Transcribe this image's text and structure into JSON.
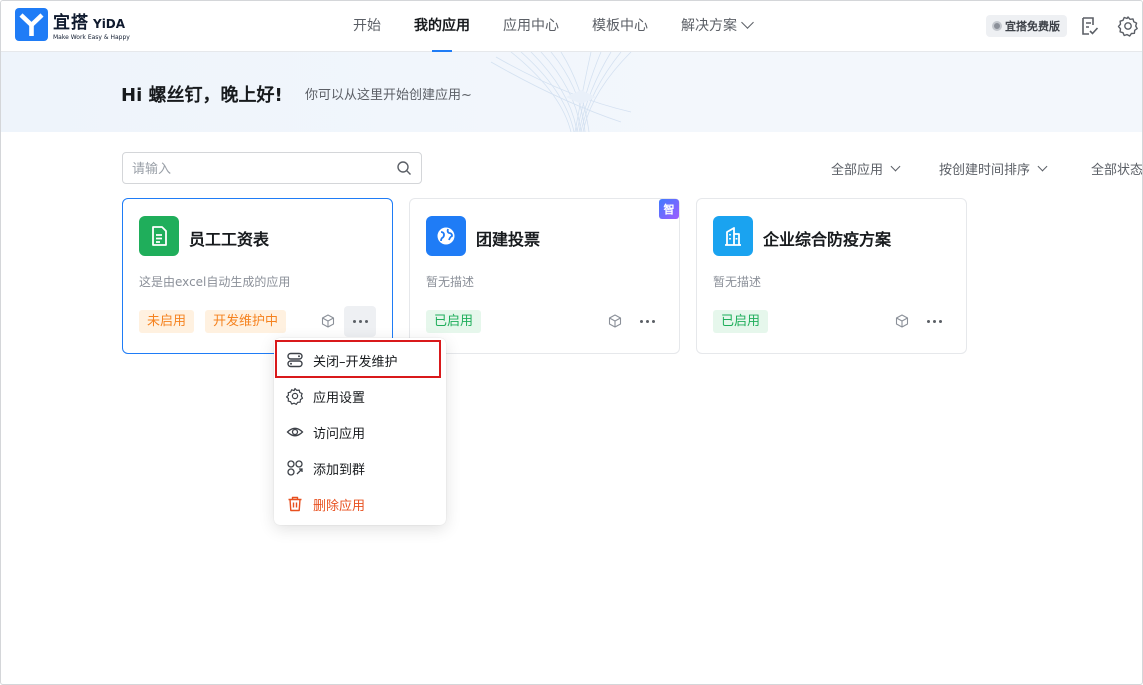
{
  "header": {
    "logo": {
      "cn": "宜搭",
      "en": "YiDA",
      "tagline": "Make Work Easy & Happy"
    },
    "nav": [
      {
        "label": "开始",
        "active": false
      },
      {
        "label": "我的应用",
        "active": true
      },
      {
        "label": "应用中心",
        "active": false
      },
      {
        "label": "模板中心",
        "active": false
      },
      {
        "label": "解决方案",
        "active": false,
        "dropdown": true
      }
    ],
    "free_badge": "宜搭免费版",
    "icons": [
      "checklist-icon",
      "gear-icon"
    ]
  },
  "banner": {
    "greeting": "Hi 螺丝钉，晚上好!",
    "subtitle": "你可以从这里开始创建应用~"
  },
  "toolbar": {
    "search_placeholder": "请输入",
    "filters": [
      "全部应用",
      "按创建时间排序",
      "全部状态"
    ]
  },
  "apps": [
    {
      "title": "员工工资表",
      "description": "这是由excel自动生成的应用",
      "icon": "document-icon",
      "icon_color": "#1fae5b",
      "tags": [
        {
          "label": "未启用",
          "color": "orange"
        },
        {
          "label": "开发维护中",
          "color": "orange"
        }
      ],
      "selected": true
    },
    {
      "title": "团建投票",
      "description": "暂无描述",
      "icon": "globe-icon",
      "icon_color": "#1f7cf6",
      "ai_badge": "智",
      "tags": [
        {
          "label": "已启用",
          "color": "green"
        }
      ],
      "selected": false
    },
    {
      "title": "企业综合防疫方案",
      "description": "暂无描述",
      "icon": "building-icon",
      "icon_color": "#1aa3f0",
      "tags": [
        {
          "label": "已启用",
          "color": "green"
        }
      ],
      "selected": false
    }
  ],
  "context_menu": {
    "items": [
      {
        "label": "关闭–开发维护",
        "icon": "toggle-icon",
        "highlighted": true
      },
      {
        "label": "应用设置",
        "icon": "gear-icon"
      },
      {
        "label": "访问应用",
        "icon": "eye-icon"
      },
      {
        "label": "添加到群",
        "icon": "add-to-group-icon"
      },
      {
        "label": "删除应用",
        "icon": "trash-icon",
        "danger": true
      }
    ]
  },
  "colors": {
    "accent": "#1f7cf6",
    "danger": "#e8501f",
    "highlight_box": "#d9191b"
  }
}
